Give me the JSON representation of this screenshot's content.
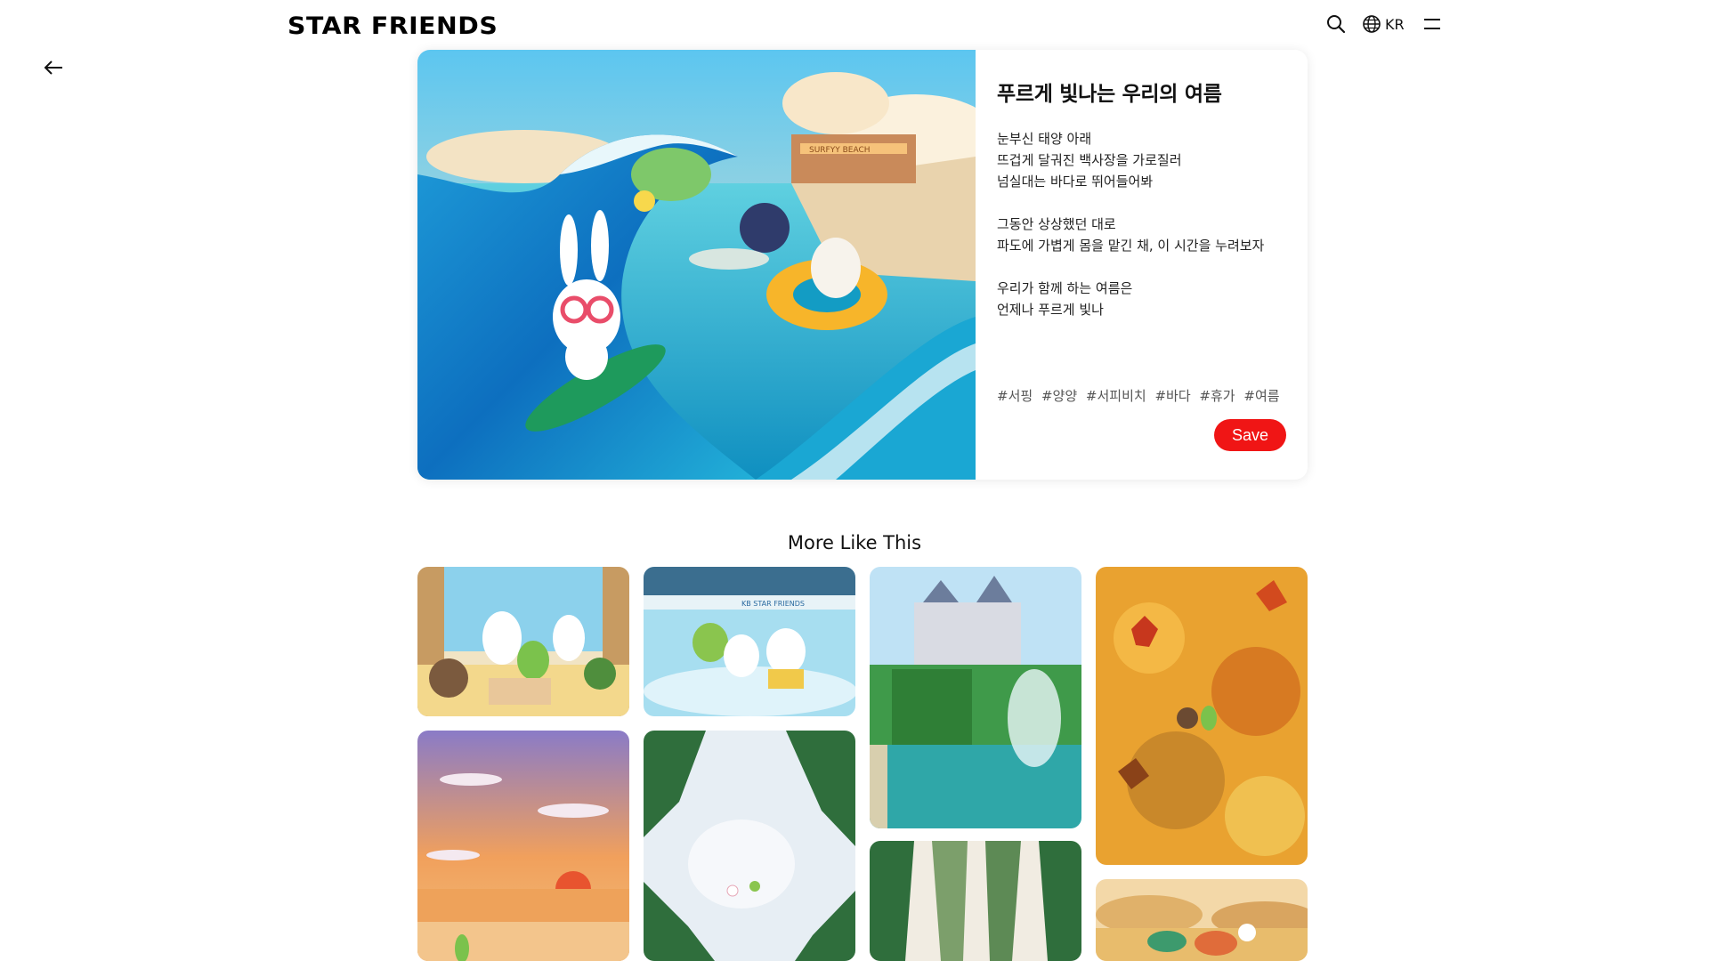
{
  "header": {
    "logo": "STAR FRIENDS",
    "search_icon": "search-icon",
    "lang_icon": "globe-icon",
    "lang_label": "KR",
    "menu_icon": "menu-icon"
  },
  "back_icon": "arrow-left-icon",
  "pin": {
    "title": "푸르게 빛나는 우리의 여름",
    "description": [
      "눈부신 태양 아래",
      "뜨겁게 달궈진 백사장을 가로질러",
      "넘실대는 바다로 뛰어들어봐",
      "",
      "그동안 상상했던 대로",
      "파도에 가볍게 몸을 맡긴 채, 이 시간을 누려보자",
      "",
      "우리가 함께 하는 여름은",
      "언제나 푸르게 빛나"
    ],
    "tags": [
      "#서핑",
      "#양양",
      "#서피비치",
      "#바다",
      "#휴가",
      "#여름"
    ],
    "save_label": "Save",
    "image_sign": "SURFYY BEACH",
    "save_color": "#f01515"
  },
  "more": {
    "title": "More Like This",
    "tiles": [
      {
        "name": "tile-traditional-room"
      },
      {
        "name": "tile-ice-skating"
      },
      {
        "name": "tile-palace-fountain"
      },
      {
        "name": "tile-autumn-leaves"
      },
      {
        "name": "tile-sunset-beach"
      },
      {
        "name": "tile-snowy-forest"
      },
      {
        "name": "tile-snow-trees"
      },
      {
        "name": "tile-autumn-field"
      }
    ],
    "tile_sign_1": "KB STAR FRIENDS"
  }
}
